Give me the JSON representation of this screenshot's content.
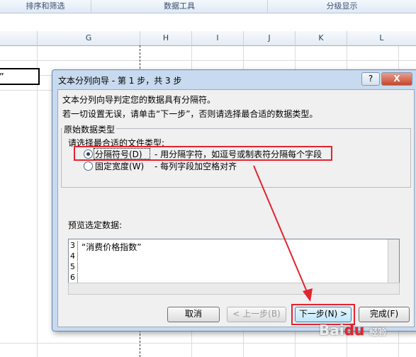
{
  "ribbon": {
    "groups": [
      "排序和筛选",
      "数据工具",
      "分级显示"
    ]
  },
  "sheet": {
    "columns": [
      "G",
      "H",
      "I",
      "J",
      "K",
      "L"
    ],
    "cell_text": "数”"
  },
  "dialog": {
    "title": "文本分列向导 - 第 1 步，共 3 步",
    "help_label": "?",
    "close_label": "X",
    "line1": "文本分列向导判定您的数据具有分隔符。",
    "line2": "若一切设置无误，请单击“下一步”，否则请选择最合适的数据类型。",
    "group_title": "原始数据类型",
    "subtitle": "请选择最合适的文件类型:",
    "option_delimited": "分隔符号(D)",
    "option_delimited_desc": "- 用分隔字符，如逗号或制表符分隔每个字段",
    "option_fixed": "固定宽度(W)",
    "option_fixed_desc": "- 每列字段加空格对齐",
    "preview_label": "预览选定数据:",
    "preview_rows": [
      {
        "n": "3",
        "text": "“消费价格指数”"
      },
      {
        "n": "4",
        "text": ""
      },
      {
        "n": "5",
        "text": ""
      },
      {
        "n": "6",
        "text": ""
      }
    ],
    "buttons": {
      "cancel": "取消",
      "back": "< 上一步(B)",
      "next": "下一步(N) >",
      "finish": "完成(F)"
    }
  },
  "watermark": "Baidu 经验",
  "colors": {
    "annotation_red": "#e4232f",
    "dialog_frame": "#c8daef"
  }
}
